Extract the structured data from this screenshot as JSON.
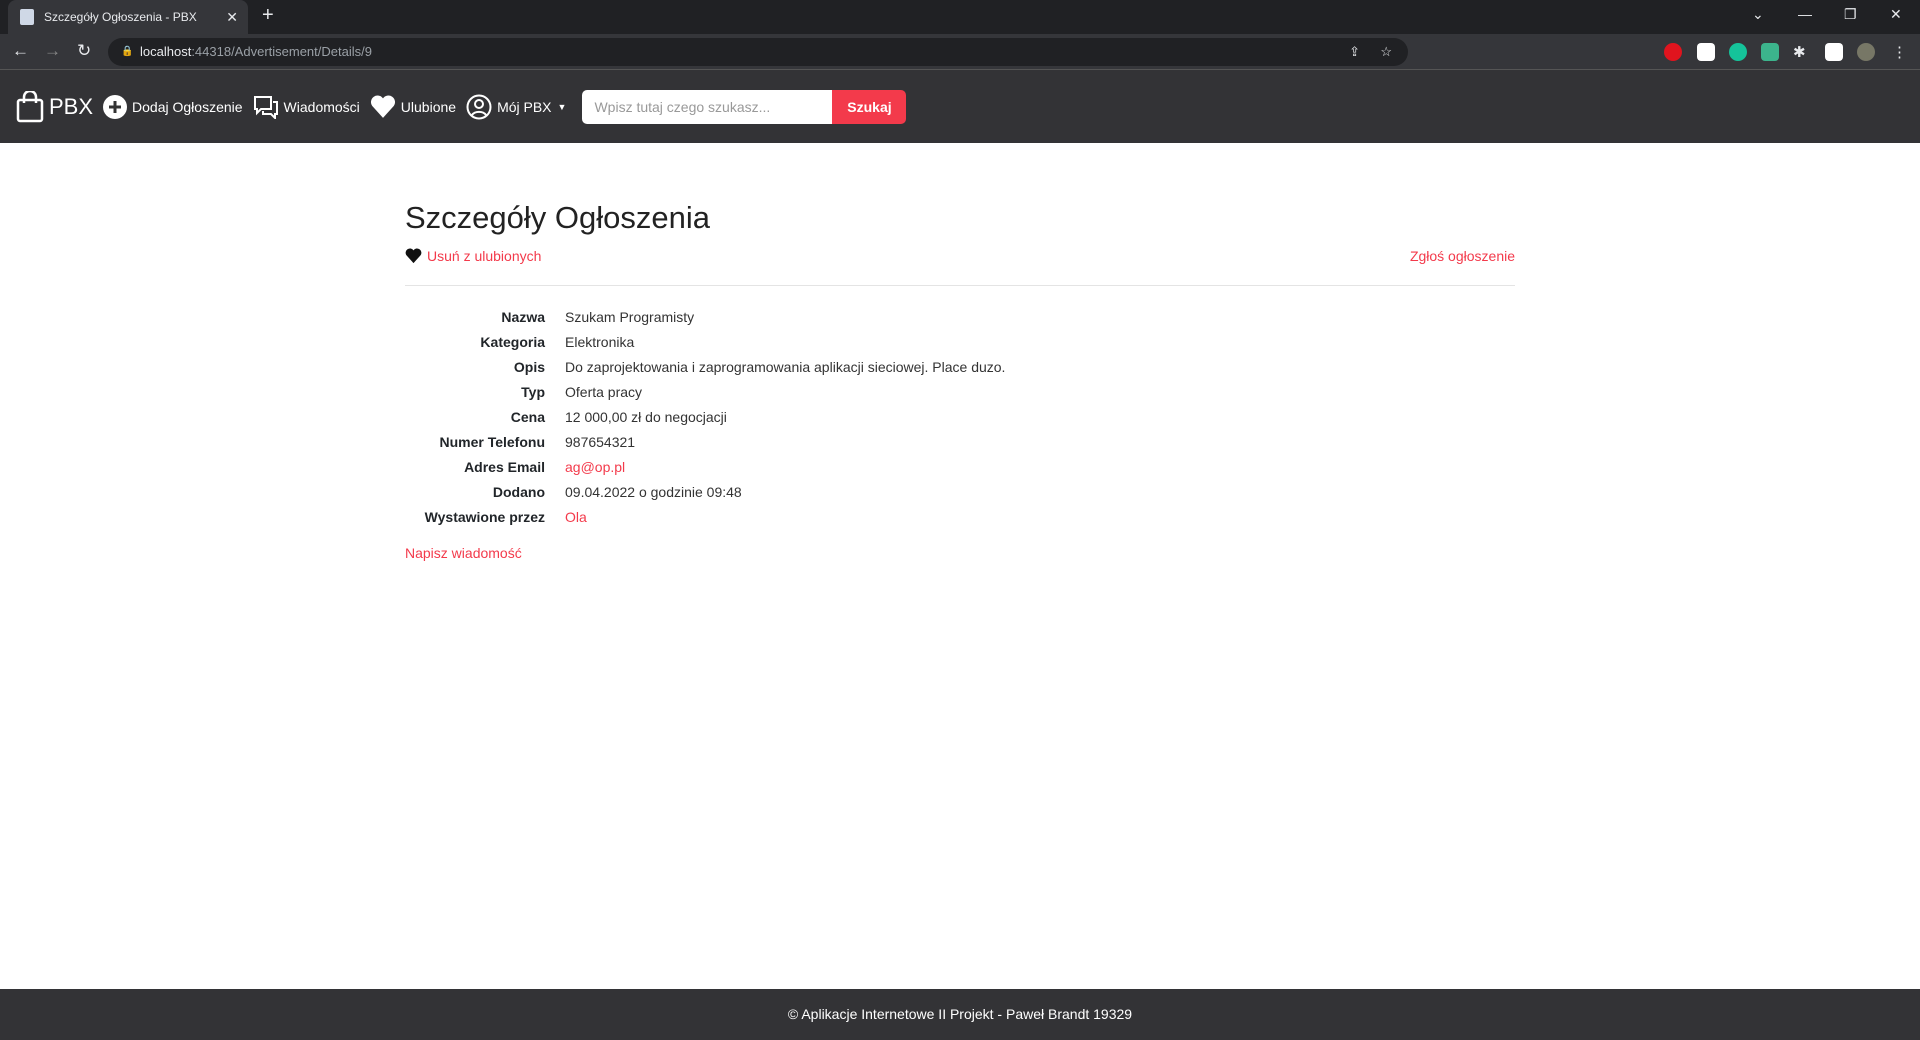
{
  "browser": {
    "tab_title": "Szczegóły Ogłoszenia - PBX",
    "url_host": "localhost",
    "url_rest": ":44318/Advertisement/Details/9"
  },
  "navbar": {
    "brand": "PBX",
    "add": "Dodaj Ogłoszenie",
    "messages": "Wiadomości",
    "favorites": "Ulubione",
    "account": "Mój PBX",
    "search_placeholder": "Wpisz tutaj czego szukasz...",
    "search_button": "Szukaj"
  },
  "page": {
    "title": "Szczegóły Ogłoszenia",
    "remove_favorite": "Usuń z ulubionych",
    "report": "Zgłoś ogłoszenie",
    "write_message": "Napisz wiadomość",
    "details": [
      {
        "label": "Nazwa",
        "value": "Szukam Programisty"
      },
      {
        "label": "Kategoria",
        "value": "Elektronika"
      },
      {
        "label": "Opis",
        "value": "Do zaprojektowania i zaprogramowania aplikacji sieciowej. Place duzo."
      },
      {
        "label": "Typ",
        "value": "Oferta pracy"
      },
      {
        "label": "Cena",
        "value": "12 000,00 zł do negocjacji"
      },
      {
        "label": "Numer Telefonu",
        "value": "987654321"
      },
      {
        "label": "Adres Email",
        "value": "ag@op.pl"
      },
      {
        "label": "Dodano",
        "value": "09.04.2022 o godzinie 09:48"
      },
      {
        "label": "Wystawione przez",
        "value": "Ola"
      }
    ]
  },
  "footer": {
    "text": "© Aplikacje Internetowe II Projekt - Paweł Brandt 19329"
  },
  "colors": {
    "accent": "#f33a4b",
    "navbar": "#333336"
  }
}
